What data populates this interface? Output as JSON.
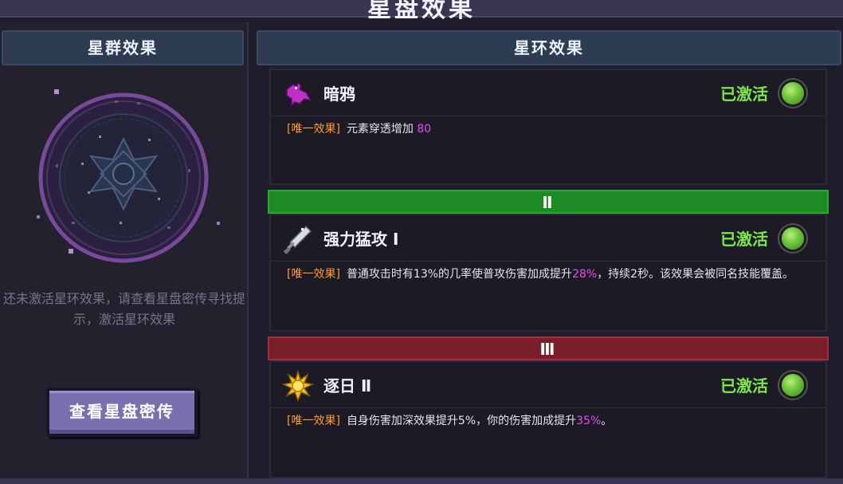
{
  "header": {
    "title": "星盘效果"
  },
  "left_panel": {
    "title": "星群效果",
    "hint": "还未激活星环效果，请查看星盘密传寻找提示，激活星环效果",
    "button_label": "查看星盘密传"
  },
  "right_panel": {
    "title": "星环效果"
  },
  "tiers": [
    {
      "label": "Ⅱ",
      "color": "#1e8a26"
    },
    {
      "label": "Ⅲ",
      "color": "#7a1e2c"
    }
  ],
  "effects": [
    {
      "name": "暗鸦",
      "icon": "raven-icon",
      "status": "已激活",
      "tag": "[唯一效果]",
      "desc_before": "元素穿透增加 ",
      "desc_highlight": "80",
      "desc_after": ""
    },
    {
      "name": "强力猛攻 Ⅰ",
      "icon": "sword-icon",
      "status": "已激活",
      "tag": "[唯一效果]",
      "desc_before": "普通攻击时有13%的几率使普攻伤害加成提升",
      "desc_highlight": "28%",
      "desc_after": "，持续2秒。该效果会被同名技能覆盖。"
    },
    {
      "name": "逐日 Ⅱ",
      "icon": "sun-icon",
      "status": "已激活",
      "tag": "[唯一效果]",
      "desc_before": "自身伤害加深效果提升5%，你的伤害加成提升",
      "desc_highlight": "35%",
      "desc_after": "。"
    }
  ],
  "colors": {
    "active_status": "#7ee84a",
    "tag": "#ff9a2e",
    "highlight": "#e050f0",
    "button": "#7a70b0"
  }
}
